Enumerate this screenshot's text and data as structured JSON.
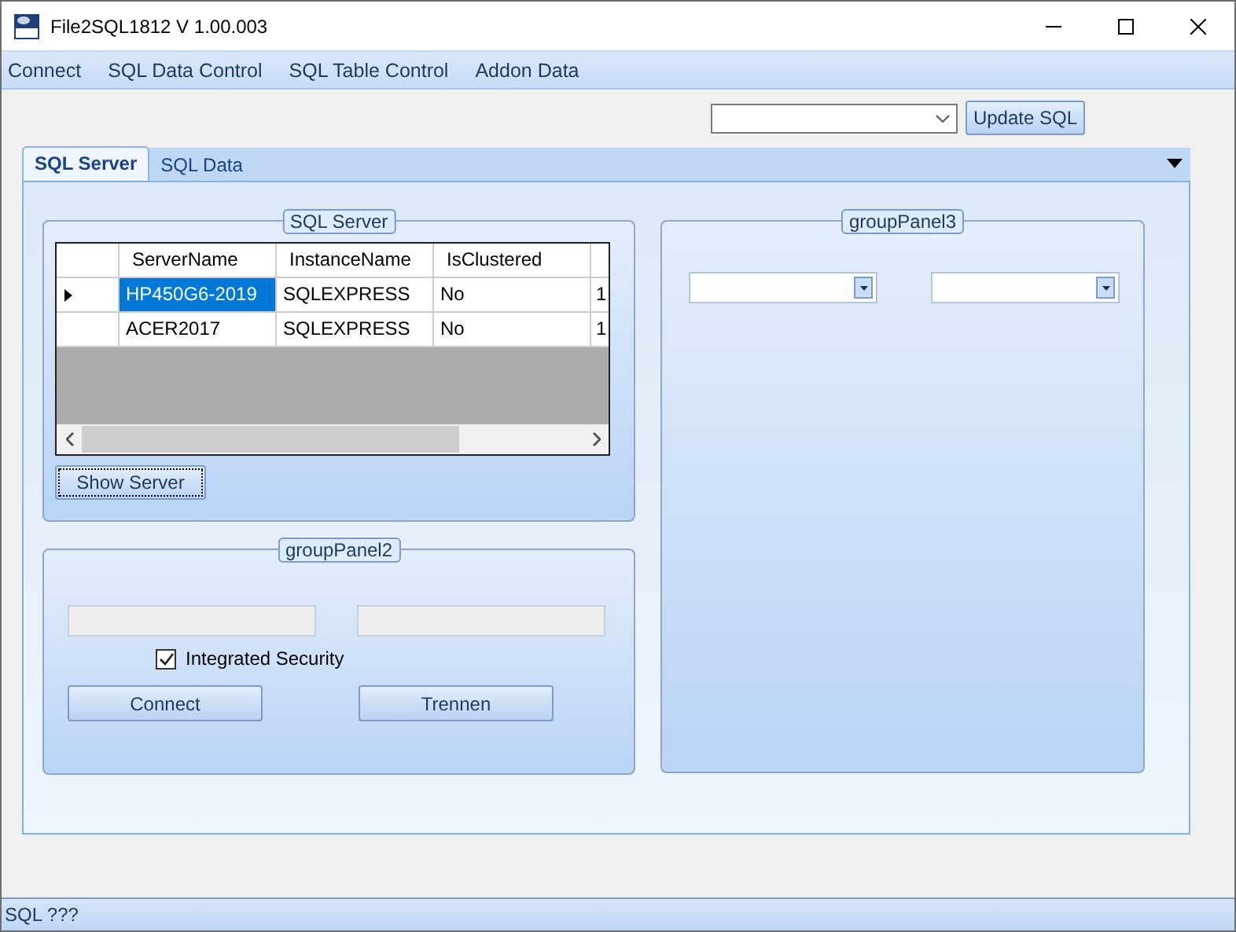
{
  "window": {
    "title": "File2SQL1812 V 1.00.003"
  },
  "menu": [
    "Connect",
    "SQL Data Control",
    "SQL Table Control",
    "Addon Data"
  ],
  "toolbar": {
    "button": "Update SQL"
  },
  "tabs": [
    {
      "label": "SQL Server",
      "selected": true
    },
    {
      "label": "SQL Data",
      "selected": false
    }
  ],
  "server_panel": {
    "title": "SQL Server",
    "table": {
      "columns": [
        "ServerName",
        "InstanceName",
        "IsClustered"
      ],
      "rows": [
        {
          "selected": true,
          "cells": [
            "HP450G6-2019",
            "SQLEXPRESS",
            "No",
            "1"
          ]
        },
        {
          "selected": false,
          "cells": [
            "ACER2017",
            "SQLEXPRESS",
            "No",
            "1"
          ]
        }
      ]
    },
    "button": "Show Server"
  },
  "connect_panel": {
    "title": "groupPanel2",
    "checkbox": {
      "label": "Integrated Security",
      "checked": true
    },
    "buttons": [
      "Connect",
      "Trennen"
    ]
  },
  "panel3": {
    "title": "groupPanel3"
  },
  "status_bar": "SQL ???"
}
